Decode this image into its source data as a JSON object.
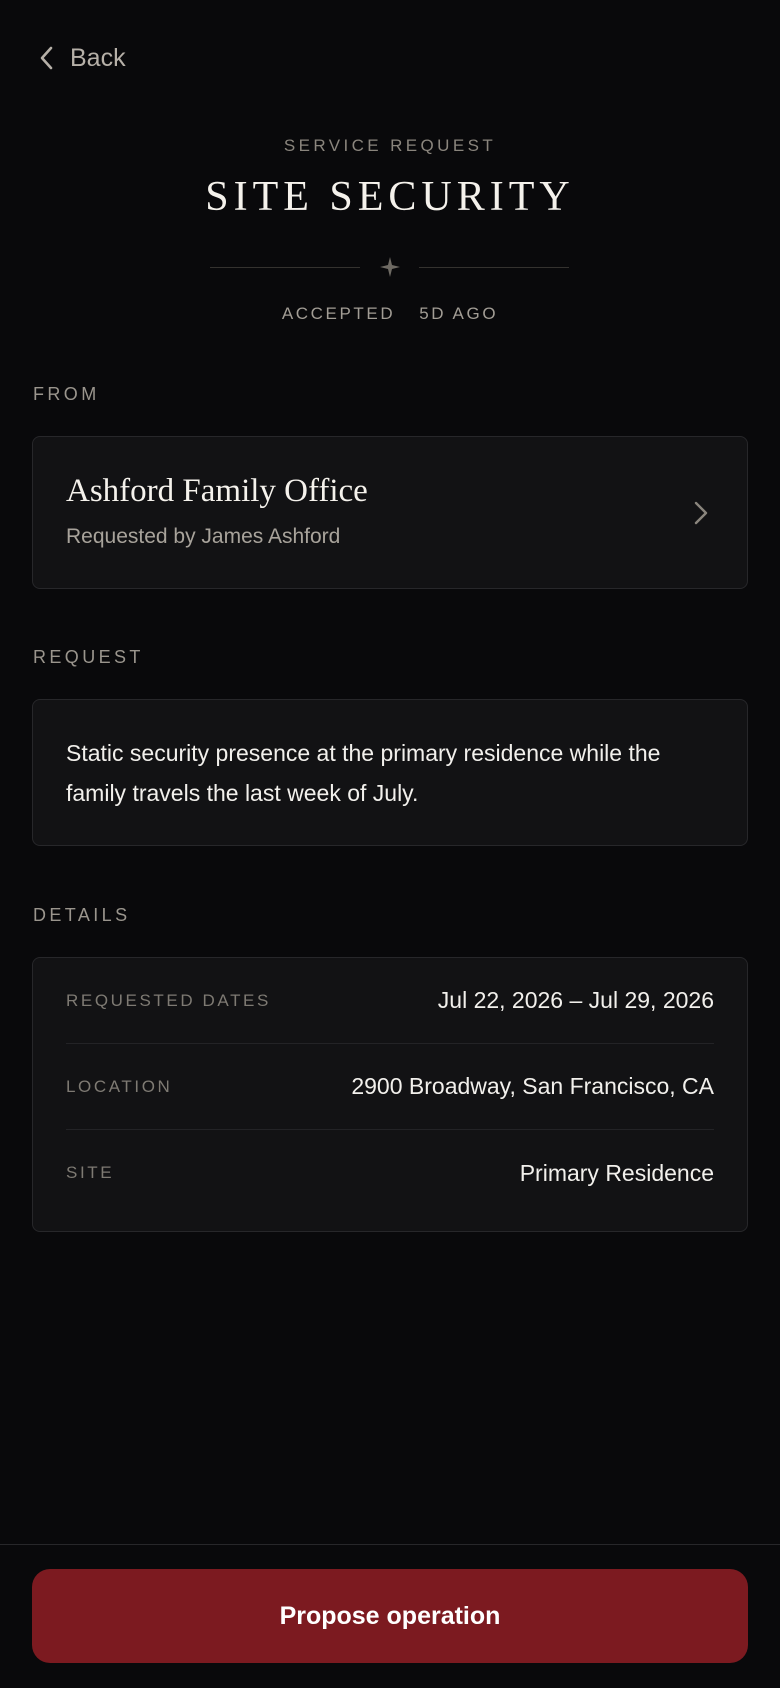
{
  "nav": {
    "back_label": "Back",
    "back_icon": "chevron-left-icon"
  },
  "header": {
    "eyebrow": "SERVICE REQUEST",
    "title": "SITE SECURITY",
    "ornament_icon": "four-point-star-icon",
    "status": "ACCEPTED",
    "age": "5D AGO"
  },
  "from": {
    "section_label": "FROM",
    "name": "Ashford Family Office",
    "requested_by": "Requested by James Ashford",
    "chevron_icon": "chevron-right-icon"
  },
  "request": {
    "section_label": "REQUEST",
    "text": "Static security presence at the primary residence while the family travels the last week of July."
  },
  "details": {
    "section_label": "DETAILS",
    "rows": [
      {
        "key": "REQUESTED DATES",
        "value": "Jul 22, 2026 – Jul 29, 2026"
      },
      {
        "key": "LOCATION",
        "value": "2900 Broadway, San Francisco, CA"
      },
      {
        "key": "SITE",
        "value": "Primary Residence"
      }
    ]
  },
  "footer": {
    "primary_action": "Propose operation"
  },
  "colors": {
    "background": "#09090b",
    "card": "#121214",
    "accent": "#7c1a20",
    "muted_text": "#9a958d"
  }
}
